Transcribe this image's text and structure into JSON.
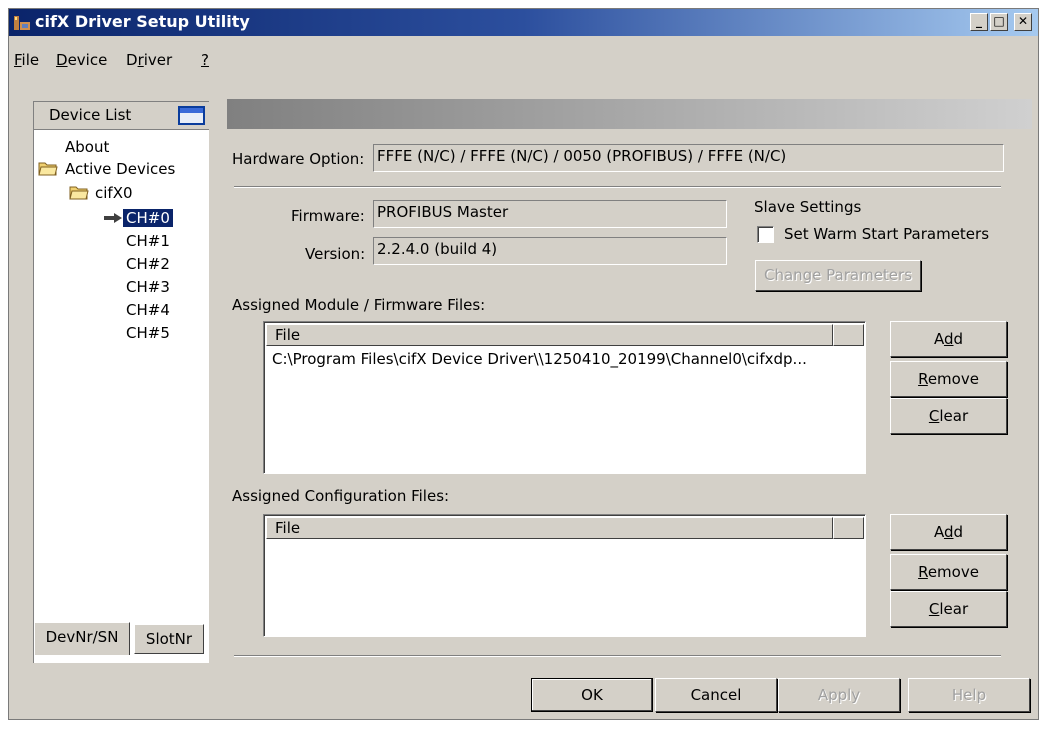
{
  "window": {
    "title": "cifX Driver Setup Utility"
  },
  "caption_buttons": {
    "minimize": "_",
    "maximize": "□",
    "close": "✕"
  },
  "menu": [
    {
      "label": "File",
      "hotkey": "F",
      "rest": "ile"
    },
    {
      "label": "Device",
      "hotkey": "D",
      "rest": "evice"
    },
    {
      "label": "Driver",
      "hotkey": "r",
      "prefix": "D",
      "rest": "iver"
    },
    {
      "label": "?",
      "hotkey": "?"
    }
  ],
  "device_list": {
    "title": "Device List",
    "tree": {
      "about": "About",
      "active_devices": "Active Devices",
      "device": "cifX0",
      "channels": [
        "CH#0",
        "CH#1",
        "CH#2",
        "CH#3",
        "CH#4",
        "CH#5"
      ],
      "selected_channel": "CH#0"
    },
    "tabs": {
      "devnr": "DevNr/SN",
      "slotnr": "SlotNr"
    }
  },
  "hardware": {
    "label": "Hardware Option:",
    "value": "FFFE (N/C) / FFFE (N/C) / 0050 (PROFIBUS) / FFFE (N/C)"
  },
  "firmware": {
    "label": "Firmware:",
    "value": "PROFIBUS Master"
  },
  "version": {
    "label": "Version:",
    "value": "2.2.4.0 (build 4)"
  },
  "slave_settings": {
    "title": "Slave Settings",
    "warm_start_label": "Set Warm Start Parameters",
    "warm_start_checked": false,
    "change_params_label": "Change Parameters"
  },
  "module_files": {
    "label": "Assigned Module / Firmware Files:",
    "column": "File",
    "rows": [
      "C:\\Program Files\\cifX Device Driver\\\\1250410_20199\\Channel0\\cifxdp..."
    ],
    "buttons": {
      "add": {
        "pre": "A",
        "hot": "d",
        "post": "d"
      },
      "remove": {
        "pre": "",
        "hot": "R",
        "post": "emove"
      },
      "clear": {
        "pre": "",
        "hot": "C",
        "post": "lear"
      }
    }
  },
  "config_files": {
    "label": "Assigned Configuration Files:",
    "column": "File",
    "rows": [],
    "buttons": {
      "add": {
        "pre": "A",
        "hot": "d",
        "post": "d"
      },
      "remove": {
        "pre": "",
        "hot": "R",
        "post": "emove"
      },
      "clear": {
        "pre": "",
        "hot": "C",
        "post": "lear"
      }
    }
  },
  "footer": {
    "ok": "OK",
    "cancel": "Cancel",
    "apply": "Apply",
    "help": "Help"
  }
}
